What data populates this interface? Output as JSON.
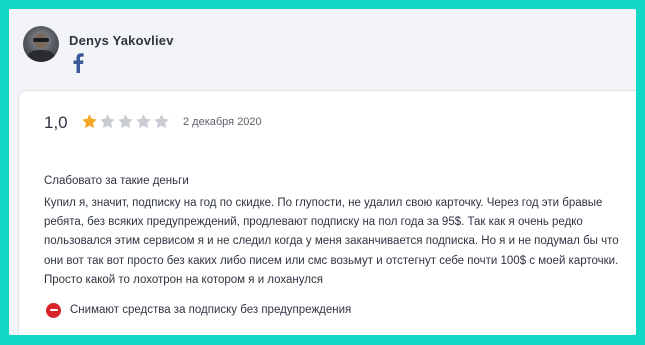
{
  "reviewer": {
    "name": "Denys Yakovliev",
    "social_icon": "facebook-icon"
  },
  "review": {
    "rating_value": "1,0",
    "rating": 1,
    "stars_max": 5,
    "date": "2 декабря 2020",
    "title": "Слабовато за такие деньги",
    "body": "Купил я, значит, подписку на год по скидке. По глупости, не удалил свою карточку. Через год эти бравые ребята, без всяких предупреждений, продлевают подписку на пол года за 95$. Так как я очень редко пользовался этим сервисом я и не следил когда у меня заканчивается подписка. Но я и не подумал бы что они вот так вот просто без каких либо писем или смс возьмут и отстегнут себе почти 100$ с моей карточки. Просто какой то лохотрон на котором я и лоханулся",
    "cons": [
      {
        "icon": "minus-circle-icon",
        "text": "Снимают средства за подписку без предупреждения"
      }
    ]
  },
  "colors": {
    "page_border": "#14d8c6",
    "star_filled": "#f5a623",
    "star_empty": "#c9ccd3",
    "con_icon": "#d8252b",
    "facebook": "#3b5998"
  }
}
